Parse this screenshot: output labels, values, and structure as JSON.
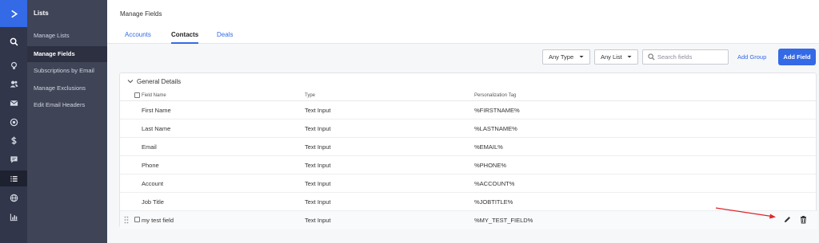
{
  "rail": {
    "items": [
      "logo-icon",
      "search-icon",
      "lightbulb-icon",
      "contacts-icon",
      "mail-icon",
      "target-icon",
      "dollar-icon",
      "chat-icon",
      "list-icon",
      "globe-icon",
      "bar-chart-icon"
    ],
    "active": "list-icon"
  },
  "subnav": {
    "title": "Lists",
    "items": [
      {
        "label": "Manage Lists"
      },
      {
        "label": "Manage Fields"
      },
      {
        "label": "Subscriptions by Email"
      },
      {
        "label": "Manage Exclusions"
      },
      {
        "label": "Edit Email Headers"
      }
    ],
    "active": "Manage Fields"
  },
  "header": {
    "title": "Manage Fields",
    "tabs": [
      {
        "label": "Accounts"
      },
      {
        "label": "Contacts"
      },
      {
        "label": "Deals"
      }
    ],
    "active_tab": "Contacts"
  },
  "toolbar": {
    "type_filter": "Any Type",
    "list_filter": "Any List",
    "search_placeholder": "Search fields",
    "add_group_label": "Add Group",
    "add_field_label": "Add Field"
  },
  "table": {
    "group_title": "General Details",
    "columns": [
      "Field Name",
      "Type",
      "Personalization Tag"
    ],
    "rows": [
      {
        "name": "First Name",
        "type": "Text Input",
        "tag": "%FIRSTNAME%"
      },
      {
        "name": "Last Name",
        "type": "Text Input",
        "tag": "%LASTNAME%"
      },
      {
        "name": "Email",
        "type": "Text Input",
        "tag": "%EMAIL%"
      },
      {
        "name": "Phone",
        "type": "Text Input",
        "tag": "%PHONE%"
      },
      {
        "name": "Account",
        "type": "Text Input",
        "tag": "%ACCOUNT%"
      },
      {
        "name": "Job Title",
        "type": "Text Input",
        "tag": "%JOBTITLE%"
      },
      {
        "name": "my test field",
        "type": "Text Input",
        "tag": "%MY_TEST_FIELD%"
      }
    ]
  },
  "colors": {
    "accent": "#356ae6",
    "rail": "#31364a",
    "subnav": "#3f4457",
    "annotation_arrow": "#e0262b"
  }
}
